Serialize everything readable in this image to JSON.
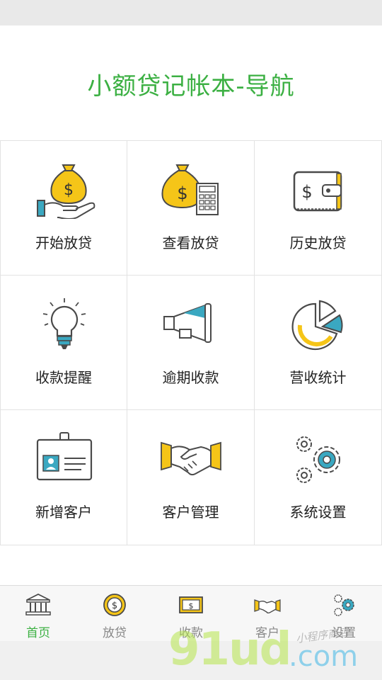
{
  "header": {
    "title": "小额贷记帐本-导航"
  },
  "grid": {
    "items": [
      {
        "label": "开始放贷",
        "icon": "money-bag-hand-icon"
      },
      {
        "label": "查看放贷",
        "icon": "money-bag-calculator-icon"
      },
      {
        "label": "历史放贷",
        "icon": "wallet-icon"
      },
      {
        "label": "收款提醒",
        "icon": "light-bulb-icon"
      },
      {
        "label": "逾期收款",
        "icon": "megaphone-icon"
      },
      {
        "label": "营收统计",
        "icon": "pie-chart-icon"
      },
      {
        "label": "新增客户",
        "icon": "id-card-icon"
      },
      {
        "label": "客户管理",
        "icon": "handshake-icon"
      },
      {
        "label": "系统设置",
        "icon": "gears-icon"
      }
    ]
  },
  "tabbar": {
    "active": "首页",
    "tabs": [
      {
        "label": "首页",
        "icon": "bank-icon"
      },
      {
        "label": "放贷",
        "icon": "coin-icon"
      },
      {
        "label": "收款",
        "icon": "banknote-icon"
      },
      {
        "label": "客户",
        "icon": "handshake-icon"
      },
      {
        "label": "设置",
        "icon": "gears-icon"
      }
    ]
  },
  "watermark": {
    "brand": "91ud",
    "domain": ".com",
    "tagline": "小程序商店"
  },
  "colors": {
    "accent": "#3cb043",
    "icon_yellow": "#f5c518",
    "icon_teal": "#3aa8c1",
    "icon_outline": "#4a4a4a"
  }
}
